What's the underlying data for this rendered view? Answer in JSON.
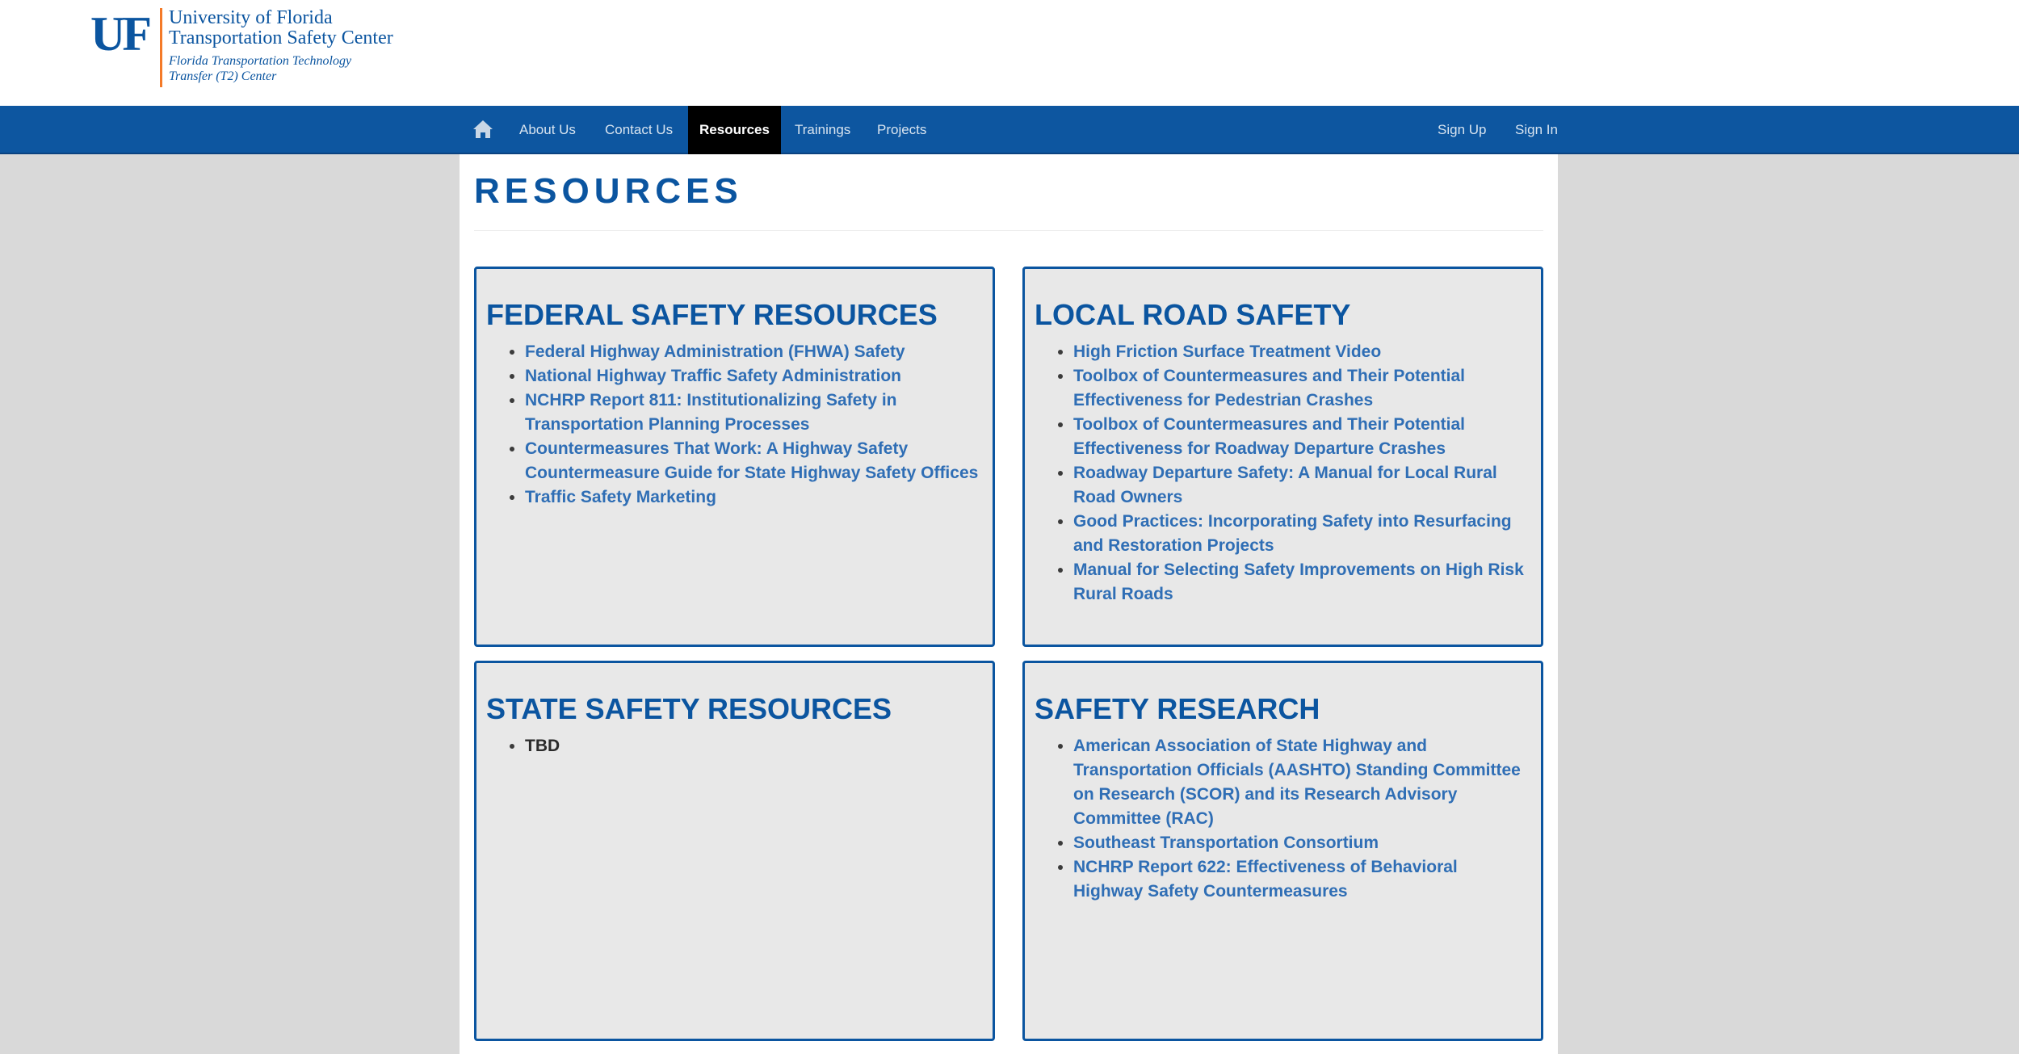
{
  "header": {
    "logo": {
      "mark": "UF",
      "line1": "University of Florida",
      "line2": "Transportation Safety Center",
      "line3": "Florida Transportation Technology",
      "line4": "Transfer (T2) Center"
    }
  },
  "nav": {
    "home_icon": "home-icon",
    "items": [
      {
        "label": "About Us"
      },
      {
        "label": "Contact Us"
      },
      {
        "label": "Resources",
        "active": true
      },
      {
        "label": "Trainings"
      },
      {
        "label": "Projects"
      }
    ],
    "right": [
      {
        "label": "Sign Up"
      },
      {
        "label": "Sign In"
      }
    ]
  },
  "page": {
    "title": "RESOURCES"
  },
  "cards": [
    {
      "title": "FEDERAL SAFETY RESOURCES",
      "links": [
        "Federal Highway Administration (FHWA) Safety",
        "National Highway Traffic Safety Administration",
        "NCHRP Report 811: Institutionalizing Safety in Transportation Planning Processes",
        "Countermeasures That Work: A Highway Safety Countermeasure Guide for State Highway Safety Offices",
        "Traffic Safety Marketing"
      ]
    },
    {
      "title": "LOCAL ROAD SAFETY",
      "links": [
        "High Friction Surface Treatment Video",
        "Toolbox of Countermeasures and Their Potential Effectiveness for Pedestrian Crashes",
        "Toolbox of Countermeasures and Their Potential Effectiveness for Roadway Departure Crashes",
        "Roadway Departure Safety: A Manual for Local Rural Road Owners",
        "Good Practices: Incorporating Safety into Resurfacing and Restoration Projects",
        "Manual for Selecting Safety Improvements on High Risk Rural Roads"
      ]
    },
    {
      "title": "STATE SAFETY RESOURCES",
      "links": [
        "TBD"
      ]
    },
    {
      "title": "SAFETY RESEARCH",
      "links": [
        "American Association of State Highway and Transportation Officials (AASHTO) Standing Committee on Research (SCOR) and its Research Advisory Committee (RAC)",
        "Southeast Transportation Consortium",
        "NCHRP Report 622: Effectiveness of Behavioral Highway Safety Countermeasures"
      ]
    }
  ],
  "colors": {
    "brand_blue": "#0b55a0",
    "nav_blue": "#0d56a0",
    "link_blue": "#2f6eb5",
    "accent_orange": "#f47a28",
    "page_bg": "#d9d9d9",
    "card_bg": "#e8e8e8"
  }
}
